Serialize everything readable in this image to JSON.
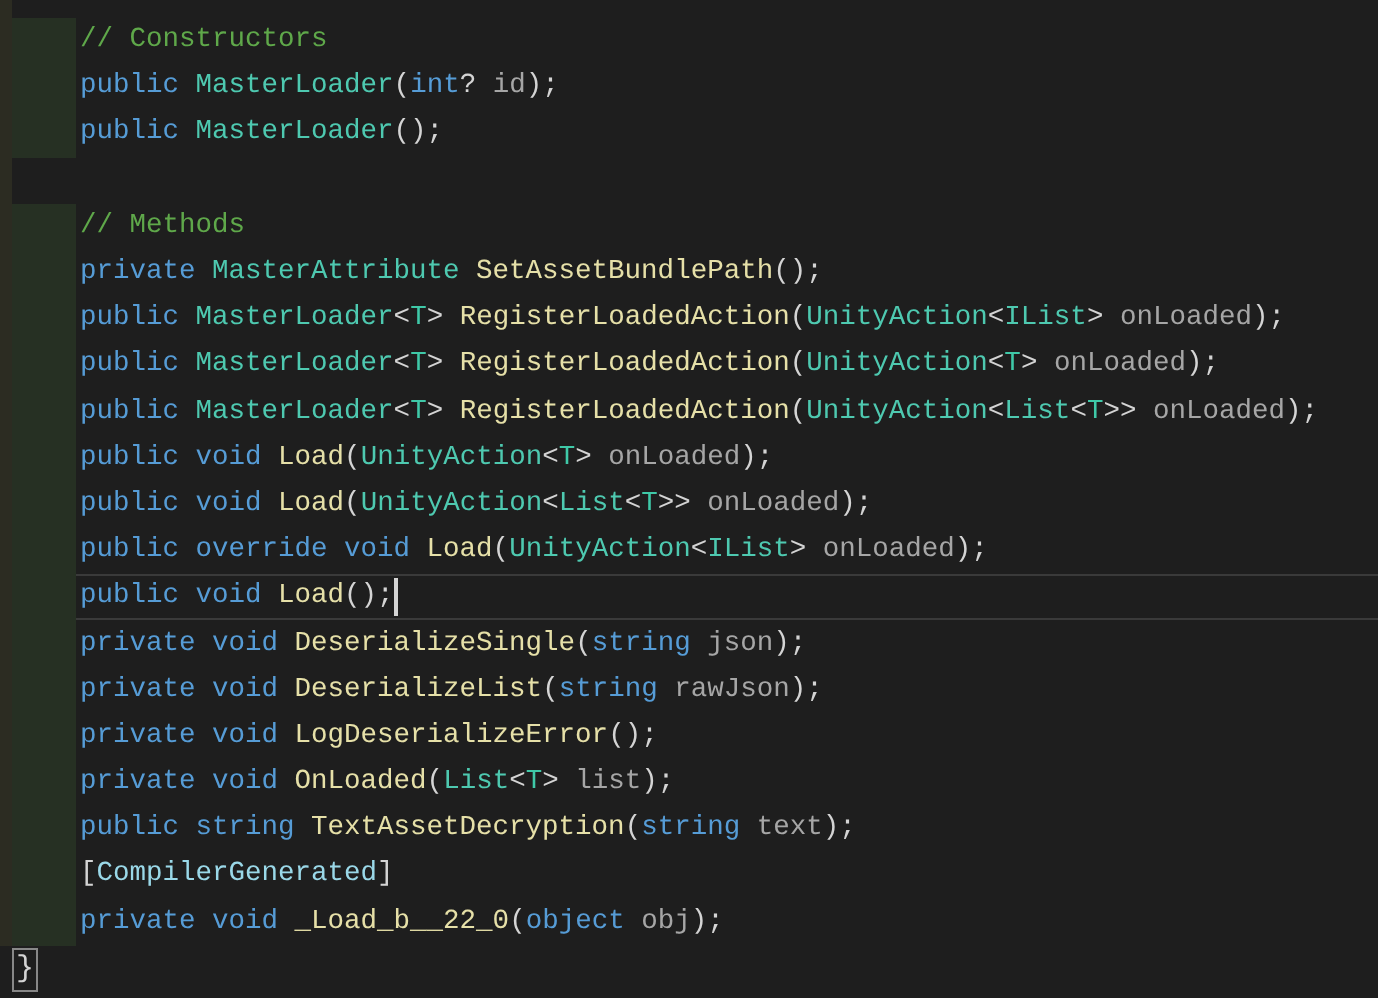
{
  "editor": {
    "lines": [
      {
        "marked": true,
        "current": false,
        "tokens": [
          {
            "kind": "comment",
            "text": "// Constructors"
          }
        ]
      },
      {
        "marked": true,
        "current": false,
        "tokens": [
          {
            "kind": "keyword",
            "text": "public "
          },
          {
            "kind": "type",
            "text": "MasterLoader"
          },
          {
            "kind": "punct",
            "text": "("
          },
          {
            "kind": "keyword",
            "text": "int"
          },
          {
            "kind": "punct",
            "text": "? "
          },
          {
            "kind": "ident",
            "text": "id"
          },
          {
            "kind": "punct",
            "text": ");"
          }
        ]
      },
      {
        "marked": true,
        "current": false,
        "tokens": [
          {
            "kind": "keyword",
            "text": "public "
          },
          {
            "kind": "type",
            "text": "MasterLoader"
          },
          {
            "kind": "punct",
            "text": "();"
          }
        ]
      },
      {
        "marked": false,
        "current": false
      },
      {
        "marked": true,
        "current": false,
        "tokens": [
          {
            "kind": "comment",
            "text": "// Methods"
          }
        ]
      },
      {
        "marked": true,
        "current": false,
        "tokens": [
          {
            "kind": "keyword",
            "text": "private "
          },
          {
            "kind": "type",
            "text": "MasterAttribute "
          },
          {
            "kind": "method",
            "text": "SetAssetBundlePath"
          },
          {
            "kind": "punct",
            "text": "();"
          }
        ]
      },
      {
        "marked": true,
        "current": false,
        "tokens": [
          {
            "kind": "keyword",
            "text": "public "
          },
          {
            "kind": "type",
            "text": "MasterLoader"
          },
          {
            "kind": "punct",
            "text": "<"
          },
          {
            "kind": "typeparam",
            "text": "T"
          },
          {
            "kind": "punct",
            "text": "> "
          },
          {
            "kind": "method",
            "text": "RegisterLoadedAction"
          },
          {
            "kind": "punct",
            "text": "("
          },
          {
            "kind": "type",
            "text": "UnityAction"
          },
          {
            "kind": "punct",
            "text": "<"
          },
          {
            "kind": "type",
            "text": "IList"
          },
          {
            "kind": "punct",
            "text": "> "
          },
          {
            "kind": "ident",
            "text": "onLoaded"
          },
          {
            "kind": "punct",
            "text": ");"
          }
        ]
      },
      {
        "marked": true,
        "current": false,
        "tokens": [
          {
            "kind": "keyword",
            "text": "public "
          },
          {
            "kind": "type",
            "text": "MasterLoader"
          },
          {
            "kind": "punct",
            "text": "<"
          },
          {
            "kind": "typeparam",
            "text": "T"
          },
          {
            "kind": "punct",
            "text": "> "
          },
          {
            "kind": "method",
            "text": "RegisterLoadedAction"
          },
          {
            "kind": "punct",
            "text": "("
          },
          {
            "kind": "type",
            "text": "UnityAction"
          },
          {
            "kind": "punct",
            "text": "<"
          },
          {
            "kind": "typeparam",
            "text": "T"
          },
          {
            "kind": "punct",
            "text": "> "
          },
          {
            "kind": "ident",
            "text": "onLoaded"
          },
          {
            "kind": "punct",
            "text": ");"
          }
        ]
      },
      {
        "marked": true,
        "current": false,
        "tokens": [
          {
            "kind": "keyword",
            "text": "public "
          },
          {
            "kind": "type",
            "text": "MasterLoader"
          },
          {
            "kind": "punct",
            "text": "<"
          },
          {
            "kind": "typeparam",
            "text": "T"
          },
          {
            "kind": "punct",
            "text": "> "
          },
          {
            "kind": "method",
            "text": "RegisterLoadedAction"
          },
          {
            "kind": "punct",
            "text": "("
          },
          {
            "kind": "type",
            "text": "UnityAction"
          },
          {
            "kind": "punct",
            "text": "<"
          },
          {
            "kind": "type",
            "text": "List"
          },
          {
            "kind": "punct",
            "text": "<"
          },
          {
            "kind": "typeparam",
            "text": "T"
          },
          {
            "kind": "punct",
            "text": ">> "
          },
          {
            "kind": "ident",
            "text": "onLoaded"
          },
          {
            "kind": "punct",
            "text": ");"
          }
        ]
      },
      {
        "marked": true,
        "current": false,
        "tokens": [
          {
            "kind": "keyword",
            "text": "public void "
          },
          {
            "kind": "method",
            "text": "Load"
          },
          {
            "kind": "punct",
            "text": "("
          },
          {
            "kind": "type",
            "text": "UnityAction"
          },
          {
            "kind": "punct",
            "text": "<"
          },
          {
            "kind": "typeparam",
            "text": "T"
          },
          {
            "kind": "punct",
            "text": "> "
          },
          {
            "kind": "ident",
            "text": "onLoaded"
          },
          {
            "kind": "punct",
            "text": ");"
          }
        ]
      },
      {
        "marked": true,
        "current": false,
        "tokens": [
          {
            "kind": "keyword",
            "text": "public void "
          },
          {
            "kind": "method",
            "text": "Load"
          },
          {
            "kind": "punct",
            "text": "("
          },
          {
            "kind": "type",
            "text": "UnityAction"
          },
          {
            "kind": "punct",
            "text": "<"
          },
          {
            "kind": "type",
            "text": "List"
          },
          {
            "kind": "punct",
            "text": "<"
          },
          {
            "kind": "typeparam",
            "text": "T"
          },
          {
            "kind": "punct",
            "text": ">> "
          },
          {
            "kind": "ident",
            "text": "onLoaded"
          },
          {
            "kind": "punct",
            "text": ");"
          }
        ]
      },
      {
        "marked": true,
        "current": false,
        "tokens": [
          {
            "kind": "keyword",
            "text": "public override void "
          },
          {
            "kind": "method",
            "text": "Load"
          },
          {
            "kind": "punct",
            "text": "("
          },
          {
            "kind": "type",
            "text": "UnityAction"
          },
          {
            "kind": "punct",
            "text": "<"
          },
          {
            "kind": "type",
            "text": "IList"
          },
          {
            "kind": "punct",
            "text": "> "
          },
          {
            "kind": "ident",
            "text": "onLoaded"
          },
          {
            "kind": "punct",
            "text": ");"
          }
        ]
      },
      {
        "marked": true,
        "current": true,
        "tokens": [
          {
            "kind": "keyword",
            "text": "public void "
          },
          {
            "kind": "method",
            "text": "Load"
          },
          {
            "kind": "punct",
            "text": "();"
          }
        ]
      },
      {
        "marked": true,
        "current": false,
        "tokens": [
          {
            "kind": "keyword",
            "text": "private void "
          },
          {
            "kind": "method",
            "text": "DeserializeSingle"
          },
          {
            "kind": "punct",
            "text": "("
          },
          {
            "kind": "keyword",
            "text": "string "
          },
          {
            "kind": "ident",
            "text": "json"
          },
          {
            "kind": "punct",
            "text": ");"
          }
        ]
      },
      {
        "marked": true,
        "current": false,
        "tokens": [
          {
            "kind": "keyword",
            "text": "private void "
          },
          {
            "kind": "method",
            "text": "DeserializeList"
          },
          {
            "kind": "punct",
            "text": "("
          },
          {
            "kind": "keyword",
            "text": "string "
          },
          {
            "kind": "ident",
            "text": "rawJson"
          },
          {
            "kind": "punct",
            "text": ");"
          }
        ]
      },
      {
        "marked": true,
        "current": false,
        "tokens": [
          {
            "kind": "keyword",
            "text": "private void "
          },
          {
            "kind": "method",
            "text": "LogDeserializeError"
          },
          {
            "kind": "punct",
            "text": "();"
          }
        ]
      },
      {
        "marked": true,
        "current": false,
        "tokens": [
          {
            "kind": "keyword",
            "text": "private void "
          },
          {
            "kind": "method",
            "text": "OnLoaded"
          },
          {
            "kind": "punct",
            "text": "("
          },
          {
            "kind": "type",
            "text": "List"
          },
          {
            "kind": "punct",
            "text": "<"
          },
          {
            "kind": "typeparam",
            "text": "T"
          },
          {
            "kind": "punct",
            "text": "> "
          },
          {
            "kind": "ident",
            "text": "list"
          },
          {
            "kind": "punct",
            "text": ");"
          }
        ]
      },
      {
        "marked": true,
        "current": false,
        "tokens": [
          {
            "kind": "keyword",
            "text": "public string "
          },
          {
            "kind": "method",
            "text": "TextAssetDecryption"
          },
          {
            "kind": "punct",
            "text": "("
          },
          {
            "kind": "keyword",
            "text": "string "
          },
          {
            "kind": "ident",
            "text": "text"
          },
          {
            "kind": "punct",
            "text": ");"
          }
        ]
      },
      {
        "marked": true,
        "current": false,
        "tokens": [
          {
            "kind": "punct",
            "text": "["
          },
          {
            "kind": "attr",
            "text": "CompilerGenerated"
          },
          {
            "kind": "punct",
            "text": "]"
          }
        ]
      },
      {
        "marked": true,
        "current": false,
        "tokens": [
          {
            "kind": "keyword",
            "text": "private void "
          },
          {
            "kind": "method",
            "text": "_Load_b__22_0"
          },
          {
            "kind": "punct",
            "text": "("
          },
          {
            "kind": "keyword",
            "text": "object "
          },
          {
            "kind": "ident",
            "text": "obj"
          },
          {
            "kind": "punct",
            "text": ");"
          }
        ]
      }
    ],
    "fold_marker": "}"
  }
}
